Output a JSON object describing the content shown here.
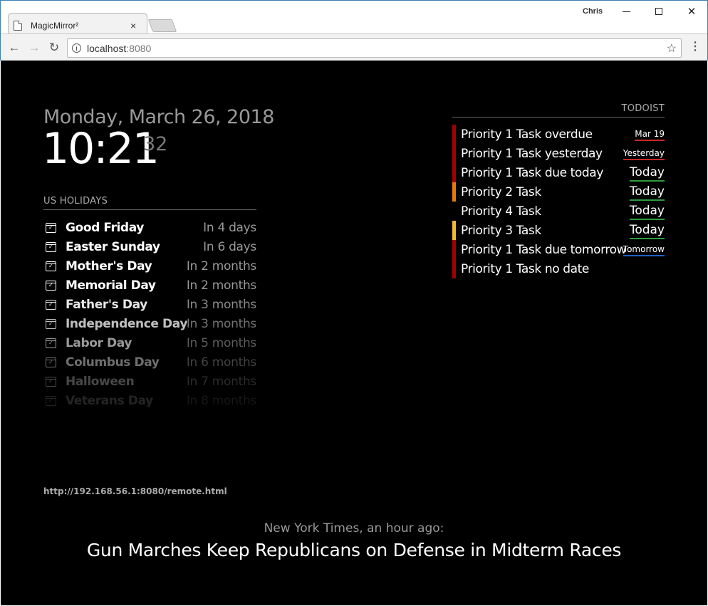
{
  "browser": {
    "tab_title": "MagicMirror²",
    "tab_close": "×",
    "user": "Chris",
    "url_host": "localhost",
    "url_port": ":8080"
  },
  "clock": {
    "date": "Monday, March 26, 2018",
    "time": "10:21",
    "seconds": "32"
  },
  "calendar": {
    "header": "US HOLIDAYS",
    "events": [
      {
        "title": "Good Friday",
        "when": "In 4 days",
        "opacity": 1.0
      },
      {
        "title": "Easter Sunday",
        "when": "In 6 days",
        "opacity": 1.0
      },
      {
        "title": "Mother's Day",
        "when": "In 2 months",
        "opacity": 1.0
      },
      {
        "title": "Memorial Day",
        "when": "In 2 months",
        "opacity": 1.0
      },
      {
        "title": "Father's Day",
        "when": "In 3 months",
        "opacity": 0.9
      },
      {
        "title": "Independence Day",
        "when": "In 3 months",
        "opacity": 0.75
      },
      {
        "title": "Labor Day",
        "when": "In 5 months",
        "opacity": 0.6
      },
      {
        "title": "Columbus Day",
        "when": "In 6 months",
        "opacity": 0.43
      },
      {
        "title": "Halloween",
        "when": "In 7 months",
        "opacity": 0.28
      },
      {
        "title": "Veterans Day",
        "when": "In 8 months",
        "opacity": 0.14
      }
    ]
  },
  "todoist": {
    "header": "TODOIST",
    "tasks": [
      {
        "title": "Priority 1 Task overdue",
        "due": "Mar 19",
        "priority_color": "#a30000",
        "due_underline": "#c62828",
        "small": true
      },
      {
        "title": "Priority 1 Task yesterday",
        "due": "Yesterday",
        "priority_color": "#a30000",
        "due_underline": "#c62828",
        "small": true
      },
      {
        "title": "Priority 1 Task due today",
        "due": "Today",
        "priority_color": "#a30000",
        "due_underline": "#2e9b3e",
        "small": false
      },
      {
        "title": "Priority 2 Task",
        "due": "Today",
        "priority_color": "#e8790a",
        "due_underline": "#2e9b3e",
        "small": false
      },
      {
        "title": "Priority 4 Task",
        "due": "Today",
        "priority_color": "#000000",
        "due_underline": "#2e9b3e",
        "small": false
      },
      {
        "title": "Priority 3 Task",
        "due": "Today",
        "priority_color": "#f2b830",
        "due_underline": "#2e9b3e",
        "small": false
      },
      {
        "title": "Priority 1 Task due tomorrow",
        "due": "Tomorrow",
        "priority_color": "#a30000",
        "due_underline": "#1e5fc8",
        "small": true
      },
      {
        "title": "Priority 1 Task no date",
        "due": "",
        "priority_color": "#a30000",
        "due_underline": "",
        "small": false
      }
    ]
  },
  "remote_url": "http://192.168.56.1:8080/remote.html",
  "news": {
    "source": "New York Times, an hour ago:",
    "headline": "Gun Marches Keep Republicans on Defense in Midterm Races"
  }
}
